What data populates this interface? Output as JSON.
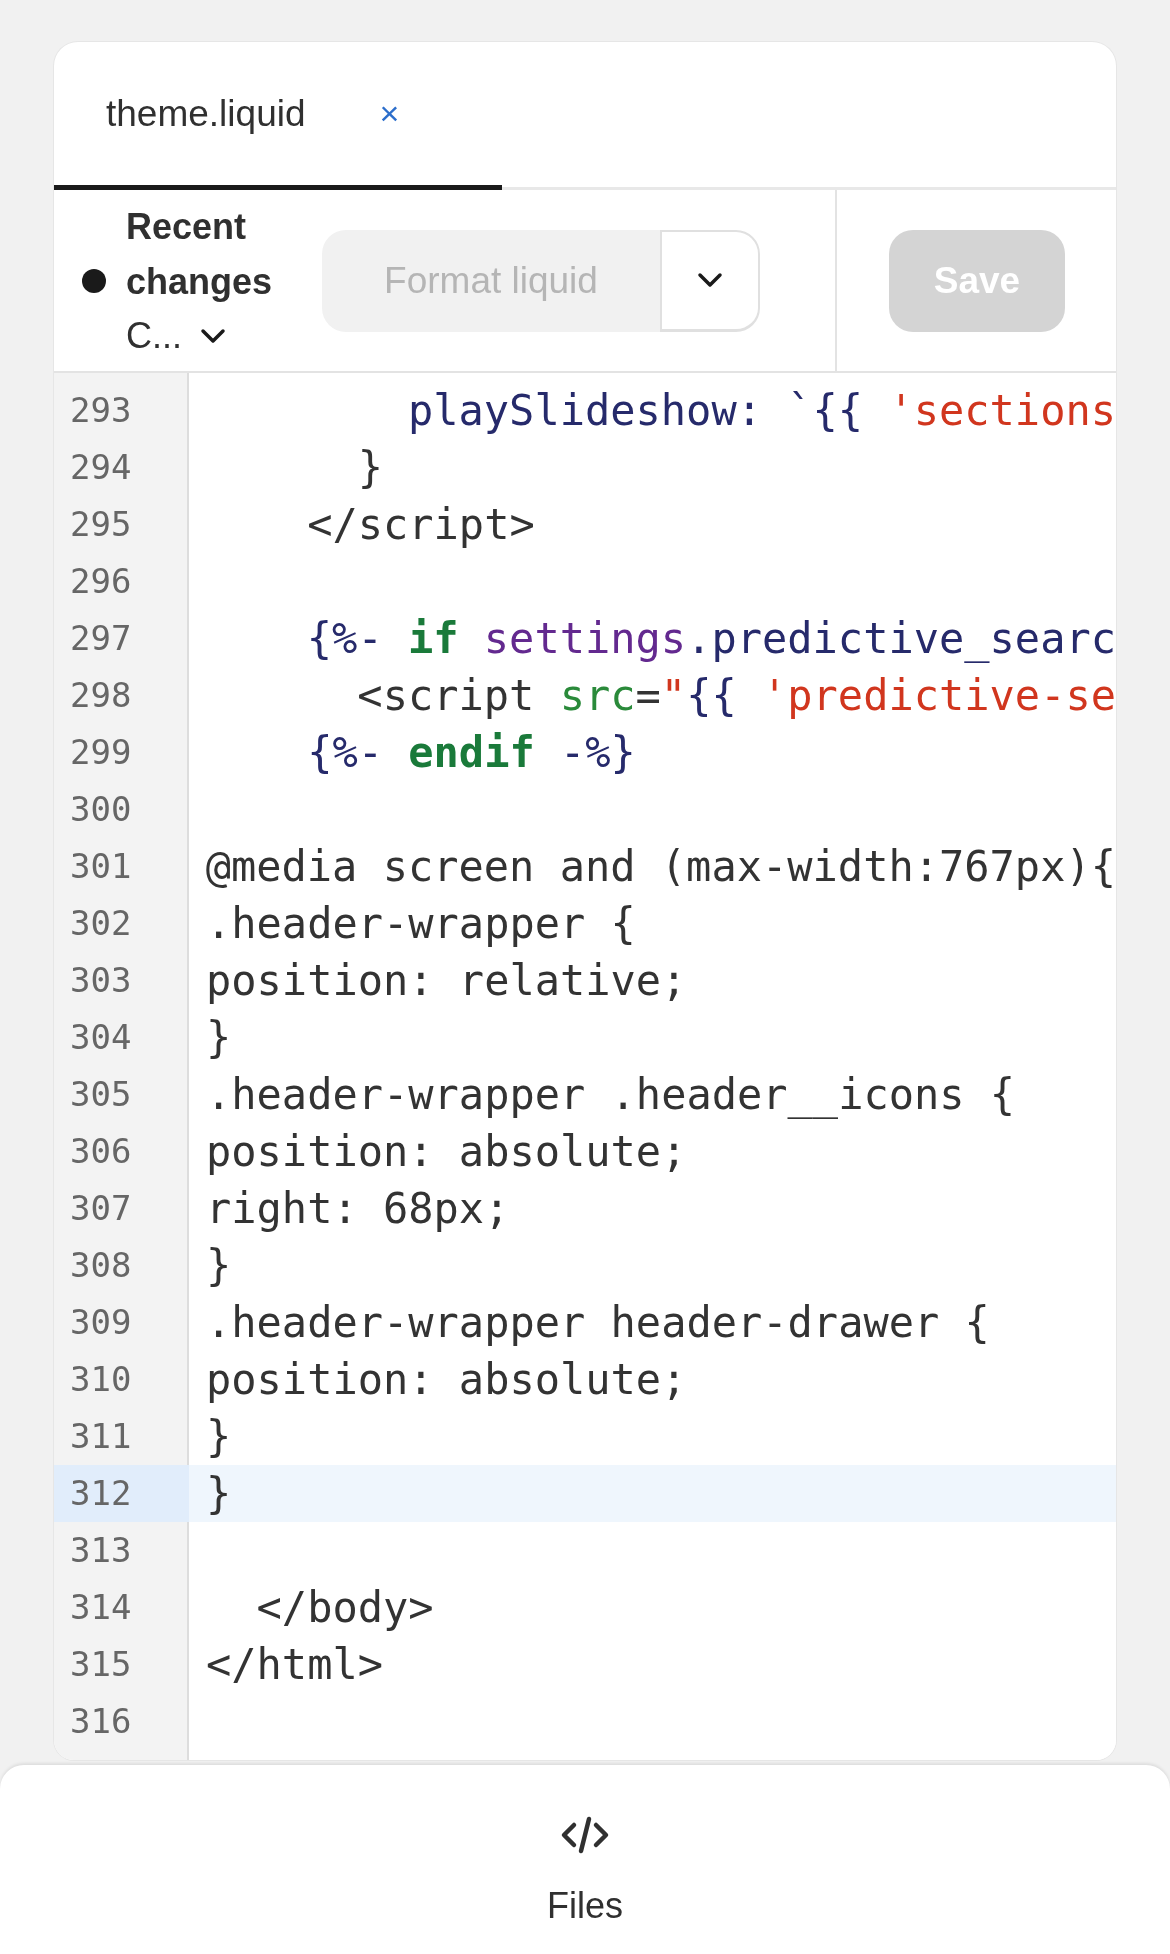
{
  "tabs": [
    {
      "label": "theme.liquid",
      "close": "×",
      "selected": true
    }
  ],
  "toolbar": {
    "status_title": "Recent changes",
    "status_dropdown": "C...",
    "format_button": {
      "label": "Format liquid",
      "disabled": true
    },
    "save_button": {
      "label": "Save",
      "disabled": true
    }
  },
  "code_lines": [
    {
      "number": "293",
      "active": false,
      "tokens": [
        {
          "kind": "name",
          "text": "          playSlideshow: `{{ "
        },
        {
          "kind": "string",
          "text": "'sections"
        }
      ]
    },
    {
      "number": "294",
      "active": false,
      "tokens": [
        {
          "kind": "plain",
          "text": "      }"
        }
      ]
    },
    {
      "number": "295",
      "active": false,
      "tokens": [
        {
          "kind": "plain",
          "text": "    </script>"
        }
      ]
    },
    {
      "number": "296",
      "active": false
    },
    {
      "number": "297",
      "active": false,
      "tokens": [
        {
          "kind": "name",
          "text": "    {%- "
        },
        {
          "kind": "keyword",
          "text": "if"
        },
        {
          "kind": "variable",
          "text": " settings"
        },
        {
          "kind": "name",
          "text": ".predictive_searc"
        }
      ]
    },
    {
      "number": "298",
      "active": false,
      "tokens": [
        {
          "kind": "plain",
          "text": "      <script "
        },
        {
          "kind": "attr",
          "text": "src"
        },
        {
          "kind": "plain",
          "text": "="
        },
        {
          "kind": "string",
          "text": "\""
        },
        {
          "kind": "name",
          "text": "{{ "
        },
        {
          "kind": "string",
          "text": "'predictive-se"
        }
      ]
    },
    {
      "number": "299",
      "active": false,
      "tokens": [
        {
          "kind": "name",
          "text": "    {%- "
        },
        {
          "kind": "keyword",
          "text": "endif"
        },
        {
          "kind": "name",
          "text": " -%}"
        }
      ]
    },
    {
      "number": "300",
      "active": false
    },
    {
      "number": "301",
      "active": false,
      "tokens": [
        {
          "kind": "plain",
          "text": "@media screen and (max-width:767px){"
        }
      ]
    },
    {
      "number": "302",
      "active": false,
      "tokens": [
        {
          "kind": "plain",
          "text": ".header-wrapper {"
        }
      ]
    },
    {
      "number": "303",
      "active": false,
      "tokens": [
        {
          "kind": "plain",
          "text": "position: relative;"
        }
      ]
    },
    {
      "number": "304",
      "active": false,
      "tokens": [
        {
          "kind": "plain",
          "text": "}"
        }
      ]
    },
    {
      "number": "305",
      "active": false,
      "tokens": [
        {
          "kind": "plain",
          "text": ".header-wrapper .header__icons {"
        }
      ]
    },
    {
      "number": "306",
      "active": false,
      "tokens": [
        {
          "kind": "plain",
          "text": "position: absolute;"
        }
      ]
    },
    {
      "number": "307",
      "active": false,
      "tokens": [
        {
          "kind": "plain",
          "text": "right: 68px;"
        }
      ]
    },
    {
      "number": "308",
      "active": false,
      "tokens": [
        {
          "kind": "plain",
          "text": "}"
        }
      ]
    },
    {
      "number": "309",
      "active": false,
      "tokens": [
        {
          "kind": "plain",
          "text": ".header-wrapper header-drawer {"
        }
      ]
    },
    {
      "number": "310",
      "active": false,
      "tokens": [
        {
          "kind": "plain",
          "text": "position: absolute;"
        }
      ]
    },
    {
      "number": "311",
      "active": false,
      "tokens": [
        {
          "kind": "plain",
          "text": "}"
        }
      ]
    },
    {
      "number": "312",
      "active": true,
      "tokens": [
        {
          "kind": "plain",
          "text": "}"
        }
      ]
    },
    {
      "number": "313",
      "active": false
    },
    {
      "number": "314",
      "active": false,
      "tokens": [
        {
          "kind": "plain",
          "text": "  </body>"
        }
      ]
    },
    {
      "number": "315",
      "active": false,
      "tokens": [
        {
          "kind": "plain",
          "text": "</html>"
        }
      ]
    },
    {
      "number": "316",
      "active": false
    }
  ],
  "bottom_nav": {
    "label": "Files"
  }
}
